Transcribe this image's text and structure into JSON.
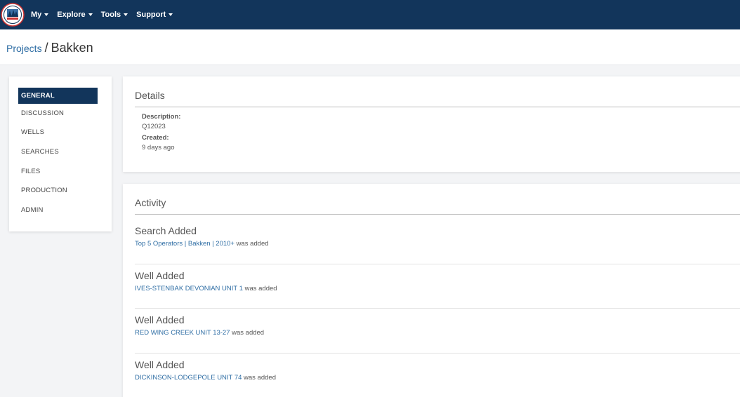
{
  "nav": {
    "items": [
      {
        "label": "My"
      },
      {
        "label": "Explore"
      },
      {
        "label": "Tools"
      },
      {
        "label": "Support"
      }
    ]
  },
  "breadcrumb": {
    "parent": "Projects",
    "separator": "/",
    "current": "Bakken"
  },
  "sidebar": {
    "items": [
      {
        "label": "GENERAL"
      },
      {
        "label": "DISCUSSION"
      },
      {
        "label": "WELLS"
      },
      {
        "label": "SEARCHES"
      },
      {
        "label": "FILES"
      },
      {
        "label": "PRODUCTION"
      },
      {
        "label": "ADMIN"
      }
    ]
  },
  "details": {
    "title": "Details",
    "description_label": "Description:",
    "description_value": "Q12023",
    "created_label": "Created:",
    "created_value": "9 days ago"
  },
  "activity": {
    "title": "Activity",
    "items": [
      {
        "title": "Search Added",
        "link": "Top 5 Operators | Bakken | 2010+",
        "suffix": " was added"
      },
      {
        "title": "Well Added",
        "link": "IVES-STENBAK DEVONIAN UNIT 1",
        "suffix": " was added"
      },
      {
        "title": "Well Added",
        "link": "RED WING CREEK UNIT 13-27",
        "suffix": " was added"
      },
      {
        "title": "Well Added",
        "link": "DICKINSON-LODGEPOLE UNIT 74",
        "suffix": " was added"
      }
    ]
  },
  "colors": {
    "nav_bg": "#12355b",
    "link": "#2e6da4",
    "active_bg": "#12355b"
  }
}
